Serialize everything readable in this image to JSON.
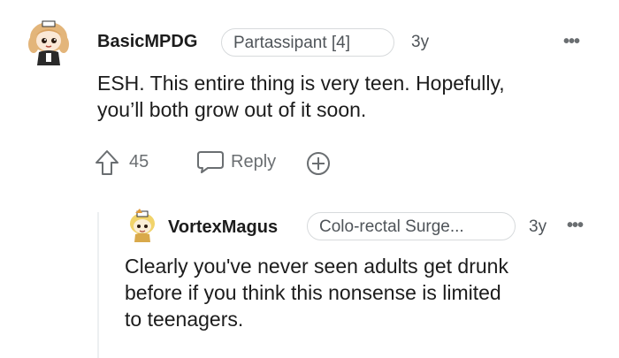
{
  "comment": {
    "username": "BasicMPDG",
    "flair": "Partassipant [4]",
    "age": "3y",
    "more": "•••",
    "body_line1": "ESH. This entire thing is very teen. Hopefully,",
    "body_line2": "you’ll both grow out of it soon.",
    "upvotes": "45",
    "reply_label": "Reply"
  },
  "reply": {
    "username": "VortexMagus",
    "flair": "Colo-rectal Surge...",
    "age": "3y",
    "more": "•••",
    "body_line1": "Clearly you've never seen adults get drunk",
    "body_line2": "before if you think this nonsense is limited",
    "body_line3": "to teenagers."
  },
  "colors": {
    "text": "#1c1c1c",
    "meta": "#4f5459",
    "icon": "#6a6e71",
    "border": "#d7dadc"
  },
  "icons": {
    "upvote": "arrow-up-icon",
    "reply": "speech-bubble-icon",
    "award": "plus-circle-icon"
  }
}
